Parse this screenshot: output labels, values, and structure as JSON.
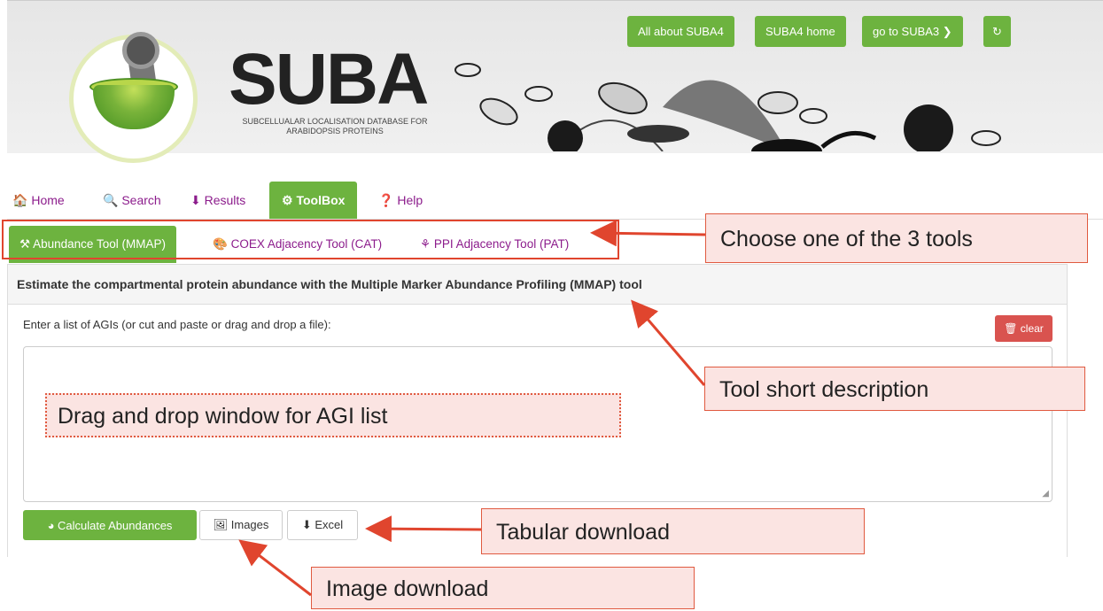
{
  "header": {
    "brand": "SUBA",
    "brand_sub": "SUBCELLUALAR LOCALISATION DATABASE FOR ARABIDOPSIS PROTEINS",
    "buttons": {
      "about": "All about SUBA4",
      "home": "SUBA4 home",
      "goto": "go to SUBA3 ❯",
      "refresh": "↻"
    }
  },
  "nav": {
    "items": [
      {
        "icon": "🏠",
        "label": "Home"
      },
      {
        "icon": "🔍",
        "label": "Search"
      },
      {
        "icon": "⬇",
        "label": "Results"
      },
      {
        "icon": "⚙",
        "label": "ToolBox"
      },
      {
        "icon": "❓",
        "label": "Help"
      }
    ]
  },
  "tabs": [
    {
      "label": "Abundance Tool (MMAP)"
    },
    {
      "label": "COEX Adjacency Tool (CAT)"
    },
    {
      "label": "PPI Adjacency Tool (PAT)"
    }
  ],
  "panel": {
    "title": "Estimate the compartmental protein abundance with the Multiple Marker Abundance Profiling (MMAP) tool",
    "input_label": "Enter a list of AGIs (or cut and paste or drag and drop a file):",
    "clear_label": "clear",
    "calc_label": "Calculate Abundances",
    "images_label": "Images",
    "excel_label": "Excel"
  },
  "annotations": {
    "tools": "Choose one of the 3 tools",
    "description": "Tool short description",
    "dragdrop": "Drag and drop window for AGI list",
    "tabular": "Tabular download",
    "image": "Image download"
  },
  "colors": {
    "green": "#6db33f",
    "purple": "#8c1c8c",
    "red": "#d9534f",
    "annotation_red": "#e0452e"
  }
}
